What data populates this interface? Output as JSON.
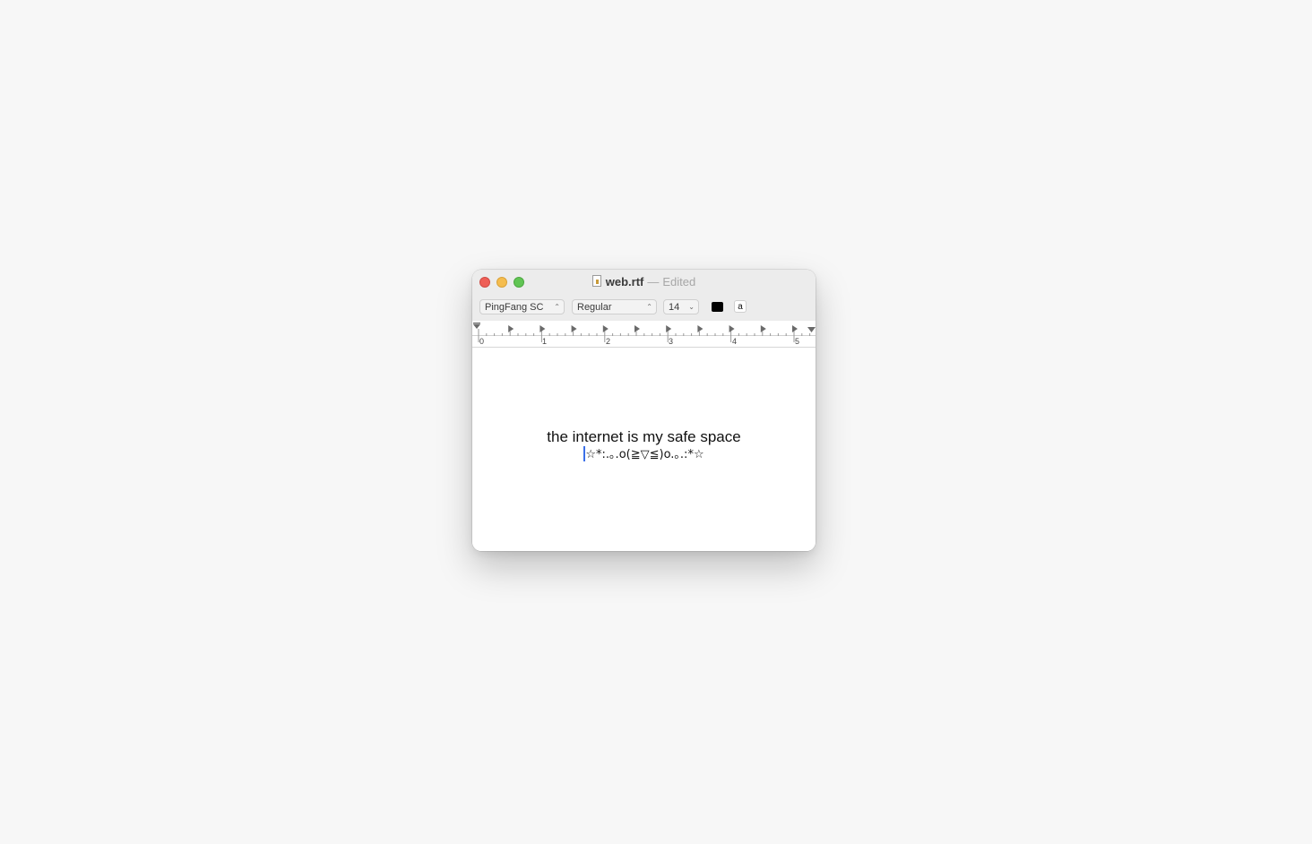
{
  "window": {
    "file_name": "web.rtf",
    "separator": "—",
    "state": "Edited"
  },
  "format_bar": {
    "font_family": "PingFang SC",
    "font_style": "Regular",
    "font_size": "14",
    "text_color": "#000000",
    "background_button_label": "a"
  },
  "ruler": {
    "labels": [
      "0",
      "1",
      "2",
      "3",
      "4",
      "5"
    ]
  },
  "document": {
    "line1": "the internet is my safe space",
    "line2": "☆*:.｡.o(≧▽≦)o.｡.:*☆"
  }
}
